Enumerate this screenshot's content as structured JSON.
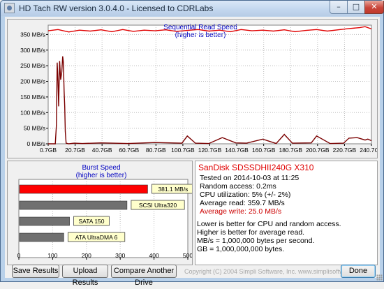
{
  "window": {
    "title": "HD Tach RW version 3.0.4.0 - Licensed to CDRLabs",
    "min_label": "–",
    "max_label": "□",
    "close_label": "✕"
  },
  "chart_data": [
    {
      "type": "line",
      "title": "Sequential Read Speed",
      "subtitle": "(higher is better)",
      "xlabel": "",
      "ylabel": "",
      "x_ticks": [
        "0.7GB",
        "20.7GB",
        "40.7GB",
        "60.7GB",
        "80.7GB",
        "100.7GB",
        "120.7GB",
        "140.7GB",
        "160.7GB",
        "180.7GB",
        "200.7GB",
        "220.7GB",
        "240.7GB"
      ],
      "y_ticks": [
        "0 MB/s",
        "50 MB/s",
        "100 MB/s",
        "150 MB/s",
        "200 MB/s",
        "250 MB/s",
        "300 MB/s",
        "350 MB/s"
      ],
      "xlim": [
        0.7,
        240.7
      ],
      "ylim": [
        0,
        380
      ],
      "grid": true,
      "series": [
        {
          "color": "#e00000",
          "x": [
            0.7,
            8,
            16,
            24,
            32,
            40,
            48,
            56,
            64,
            72,
            80,
            88,
            96,
            104,
            112,
            120,
            128,
            136,
            144,
            152,
            160,
            168,
            176,
            184,
            192,
            200,
            208,
            216,
            224,
            232,
            236,
            240.7
          ],
          "y": [
            362,
            366,
            358,
            364,
            361,
            365,
            359,
            366,
            360,
            364,
            362,
            365,
            360,
            363,
            366,
            361,
            364,
            359,
            366,
            362,
            364,
            361,
            365,
            359,
            363,
            366,
            361,
            365,
            369,
            372,
            375,
            368
          ]
        },
        {
          "color": "#7a0000",
          "x": [
            0.7,
            2,
            4,
            6,
            6.8,
            7.4,
            8,
            8.5,
            9.2,
            10,
            10.8,
            11.5,
            12,
            12.5,
            13,
            13.4,
            14,
            15,
            16,
            20,
            26,
            40,
            60,
            80,
            100,
            104,
            110,
            120,
            130,
            140,
            148,
            160,
            170,
            176,
            182,
            196,
            200,
            210,
            220,
            224,
            230,
            236,
            238,
            240.7
          ],
          "y": [
            0,
            0,
            0,
            0,
            60,
            260,
            200,
            120,
            265,
            205,
            230,
            280,
            260,
            170,
            120,
            40,
            2,
            1,
            0,
            2,
            1,
            3,
            1,
            4,
            2,
            25,
            2,
            1,
            20,
            3,
            2,
            15,
            1,
            30,
            2,
            3,
            25,
            1,
            2,
            18,
            20,
            12,
            15,
            10
          ]
        }
      ]
    },
    {
      "type": "bar",
      "title": "Burst Speed",
      "subtitle": "(higher is better)",
      "xlabel": "",
      "ylabel": "",
      "x_ticks": [
        "0",
        "100",
        "200",
        "300",
        "400",
        "500"
      ],
      "xlim": [
        0,
        500
      ],
      "categories": [
        "381.1 MB/s",
        "SCSI Ultra320",
        "SATA 150",
        "ATA UltraDMA 6"
      ],
      "values": [
        381.1,
        320,
        150,
        133
      ],
      "colors": [
        "#ff0000",
        "#707070",
        "#707070",
        "#707070"
      ]
    }
  ],
  "info": {
    "drive": "SanDisk SDSSDHII240G X310",
    "tested": "Tested on 2014-10-03 at 11:25",
    "random_access": "Random access: 0.2ms",
    "cpu": "CPU utilization: 5% (+/- 2%)",
    "avg_read": "Average read: 359.7 MB/s",
    "avg_write": "Average write: 25.0 MB/s",
    "note1": "Lower is better for CPU and random access.",
    "note2": "Higher is better for average read.",
    "note3": "MB/s = 1,000,000 bytes per second.",
    "note4": "GB = 1,000,000,000 bytes."
  },
  "buttons": {
    "save": "Save Results",
    "upload": "Upload Results",
    "compare": "Compare Another Drive",
    "done": "Done"
  },
  "copyright": "Copyright (C) 2004 Simpli Software, Inc. www.simplisoftware.com"
}
